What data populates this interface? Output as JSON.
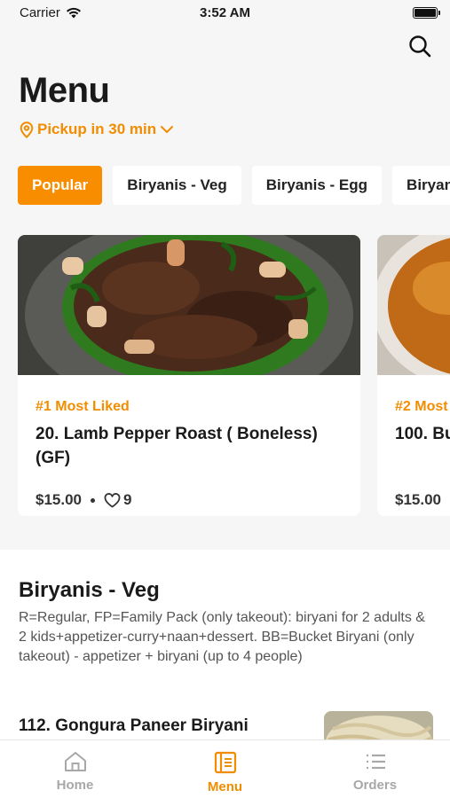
{
  "status": {
    "carrier": "Carrier",
    "time": "3:52 AM"
  },
  "header": {
    "title": "Menu",
    "pickup": "Pickup in 30 min"
  },
  "categories": [
    "Popular",
    "Biryanis - Veg",
    "Biryanis - Egg",
    "Biryanis"
  ],
  "featured": [
    {
      "rank": "#1 Most Liked",
      "name": "20. Lamb Pepper Roast ( Boneless) (GF)",
      "price": "$15.00",
      "likes": "9"
    },
    {
      "rank": "#2 Most",
      "name": "100. Bu",
      "price": "$15.00"
    }
  ],
  "section": {
    "title": "Biryanis - Veg",
    "description": "R=Regular, FP=Family Pack (only takeout): biryani for 2 adults & 2 kids+appetizer-curry+naan+dessert. BB=Bucket Biryani (only takeout) - appetizer + biryani (up to 4 people)",
    "first_item": "112. Gongura Paneer Biryani"
  },
  "tabs": [
    "Home",
    "Menu",
    "Orders"
  ],
  "colors": {
    "accent": "#f28c00"
  }
}
